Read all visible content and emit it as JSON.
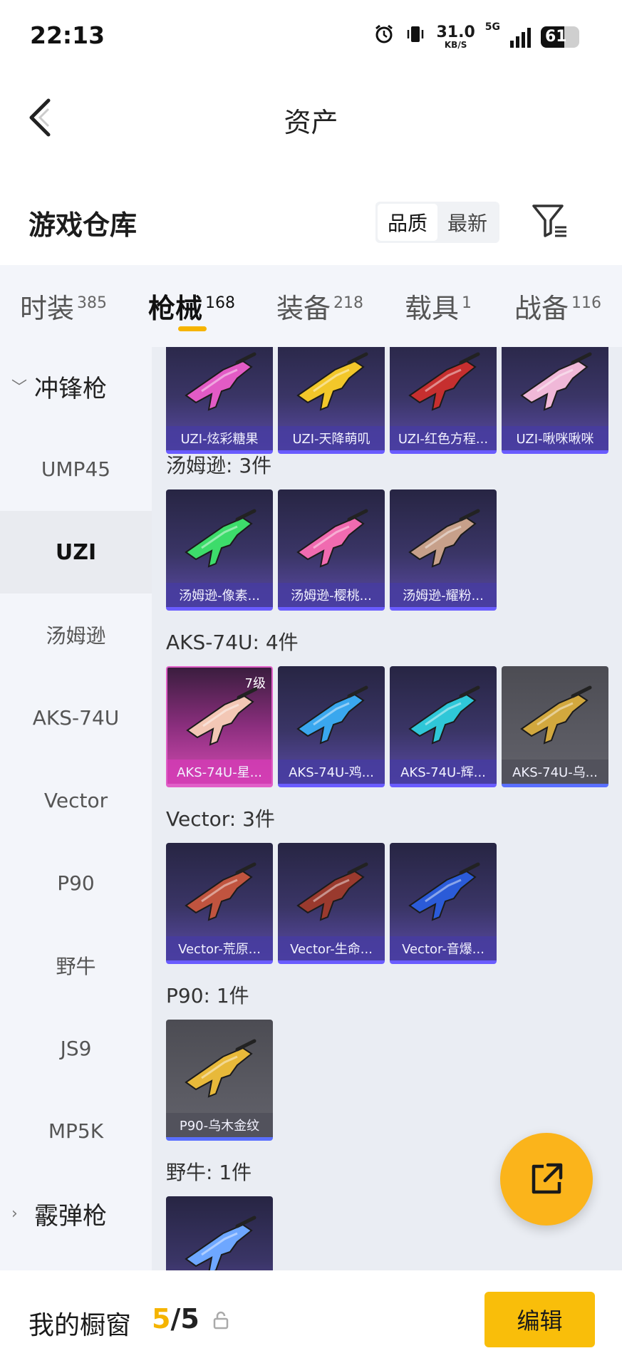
{
  "status_bar": {
    "time": "22:13",
    "net_speed_value": "31.0",
    "net_speed_unit": "KB/S",
    "network_type": "5G",
    "battery_level": "61",
    "icons": [
      "alarm-icon",
      "vibrate-icon",
      "signal-icon",
      "battery-icon"
    ]
  },
  "header": {
    "title": "资产",
    "back_icon": "chevron-left-icon"
  },
  "section": {
    "title": "游戏仓库",
    "sort_options": [
      "品质",
      "最新"
    ],
    "sort_selected": "品质",
    "filter_icon": "filter-icon"
  },
  "tabs": [
    {
      "label": "时装",
      "count": "385",
      "active": false
    },
    {
      "label": "枪械",
      "count": "168",
      "active": true
    },
    {
      "label": "装备",
      "count": "218",
      "active": false
    },
    {
      "label": "载具",
      "count": "1",
      "active": false
    },
    {
      "label": "战备",
      "count": "116",
      "active": false
    }
  ],
  "sidebar": {
    "items": [
      {
        "label": "冲锋枪",
        "type": "group",
        "expanded": true
      },
      {
        "label": "UMP45",
        "type": "item"
      },
      {
        "label": "UZI",
        "type": "item",
        "selected": true
      },
      {
        "label": "汤姆逊",
        "type": "item"
      },
      {
        "label": "AKS-74U",
        "type": "item"
      },
      {
        "label": "Vector",
        "type": "item"
      },
      {
        "label": "P90",
        "type": "item"
      },
      {
        "label": "野牛",
        "type": "item"
      },
      {
        "label": "JS9",
        "type": "item"
      },
      {
        "label": "MP5K",
        "type": "item"
      },
      {
        "label": "霰弹枪",
        "type": "group",
        "expanded": false
      }
    ]
  },
  "groups": {
    "uzi": {
      "label": "",
      "items": [
        {
          "name": "UZI-炫彩糖果",
          "tone": "purple",
          "color": "#e25bc5"
        },
        {
          "name": "UZI-天降萌叽",
          "tone": "purple",
          "color": "#f2c72a"
        },
        {
          "name": "UZI-红色方程...",
          "tone": "purple",
          "color": "#c62f2f"
        },
        {
          "name": "UZI-啾咪啾咪",
          "tone": "purple",
          "color": "#f0b8d8"
        }
      ]
    },
    "thompson": {
      "label": "汤姆逊: 3件",
      "items": [
        {
          "name": "汤姆逊-像素...",
          "tone": "purple",
          "color": "#3ddc6b"
        },
        {
          "name": "汤姆逊-樱桃...",
          "tone": "purple",
          "color": "#f06bb0"
        },
        {
          "name": "汤姆逊-耀粉...",
          "tone": "purple",
          "color": "#c7a08a"
        }
      ]
    },
    "aks74u": {
      "label": "AKS-74U: 4件",
      "items": [
        {
          "name": "AKS-74U-星...",
          "tone": "gold",
          "color": "#f3c7b5",
          "level": "7级"
        },
        {
          "name": "AKS-74U-鸡...",
          "tone": "purple",
          "color": "#3aa7ee"
        },
        {
          "name": "AKS-74U-辉...",
          "tone": "purple",
          "color": "#2fc7d8"
        },
        {
          "name": "AKS-74U-乌...",
          "tone": "grey",
          "color": "#d2a83e"
        }
      ]
    },
    "vector": {
      "label": "Vector: 3件",
      "items": [
        {
          "name": "Vector-荒原...",
          "tone": "purple",
          "color": "#c0543f"
        },
        {
          "name": "Vector-生命...",
          "tone": "purple",
          "color": "#9a3a2e"
        },
        {
          "name": "Vector-音爆...",
          "tone": "purple",
          "color": "#2b5bd8"
        }
      ]
    },
    "p90": {
      "label": "P90: 1件",
      "items": [
        {
          "name": "P90-乌木金纹",
          "tone": "grey",
          "color": "#e8b93a"
        }
      ]
    },
    "bizon": {
      "label": "野牛: 1件",
      "items": [
        {
          "name": "",
          "tone": "purple",
          "color": "#6ea7ff"
        }
      ]
    }
  },
  "fab": {
    "icon": "share-external-icon"
  },
  "bottom_bar": {
    "title": "我的橱窗",
    "count_current": "5",
    "count_sep": "/",
    "count_max": "5",
    "lock_icon": "lock-icon",
    "edit_label": "编辑"
  },
  "colors": {
    "accent": "#f6b400",
    "edit_button": "#f9be0a",
    "fab": "#fbb41b",
    "sidebar_bg": "#f3f5fa",
    "content_bg": "#eaedf3"
  }
}
